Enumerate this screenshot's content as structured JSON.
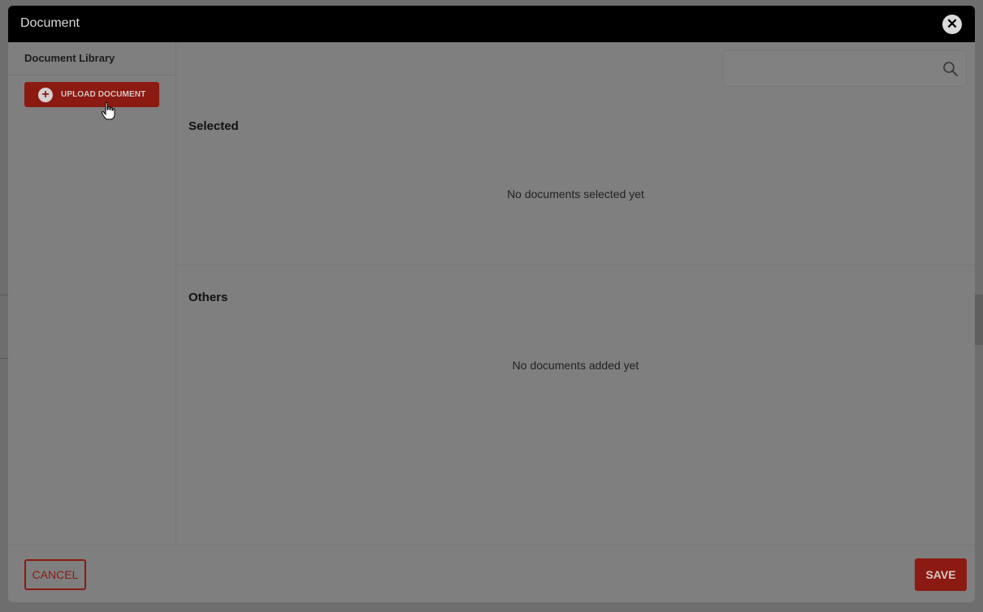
{
  "modal": {
    "title": "Document",
    "close_icon": "close-icon"
  },
  "sidebar": {
    "title": "Document Library",
    "upload_button": {
      "label": "UPLOAD DOCUMENT",
      "icon": "plus-circle-icon"
    }
  },
  "search": {
    "value": "",
    "placeholder": "",
    "icon": "search-icon"
  },
  "sections": {
    "selected": {
      "title": "Selected",
      "empty_text": "No documents selected yet"
    },
    "others": {
      "title": "Others",
      "empty_text": "No documents added yet"
    }
  },
  "footer": {
    "cancel_label": "CANCEL",
    "save_label": "SAVE"
  },
  "colors": {
    "accent": "#c62828",
    "header": "#000000"
  }
}
